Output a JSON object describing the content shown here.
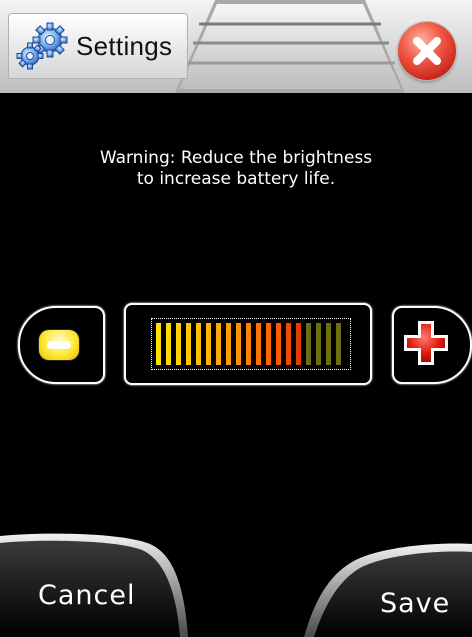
{
  "titlebar": {
    "title": "Settings",
    "icon": "gears-icon",
    "close_icon": "close-icon"
  },
  "warning": {
    "line1": "Warning: Reduce the brightness",
    "line2": "to increase battery life."
  },
  "brightness": {
    "decrease_icon": "minus-icon",
    "increase_icon": "plus-icon",
    "segments_total": 19,
    "segments_lit": 15,
    "level_fraction": 0.79,
    "lit_colors": [
      "#ffe000",
      "#ffdc00",
      "#ffd400",
      "#ffcb00",
      "#ffc100",
      "#ffb600",
      "#ffaa00",
      "#ff9d00",
      "#ff9000",
      "#ff8200",
      "#ff7400",
      "#ff6600",
      "#ff5900",
      "#f24a00",
      "#e33c00"
    ],
    "unlit_color": "#6e6e10"
  },
  "buttons": {
    "cancel_label": "Cancel",
    "save_label": "Save"
  },
  "colors": {
    "background": "#000000",
    "accent_close": "#e0402e",
    "minus_yellow": "#ffe836",
    "plus_red": "#e01b10"
  }
}
